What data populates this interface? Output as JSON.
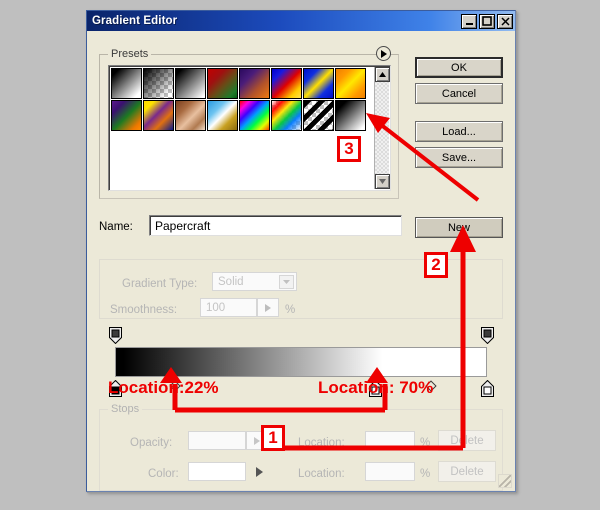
{
  "window": {
    "title": "Gradient Editor",
    "controls": [
      {
        "name": "minimize-button",
        "glyph": "_"
      },
      {
        "name": "maximize-button",
        "glyph": "□"
      },
      {
        "name": "close-button",
        "glyph": "✕"
      }
    ]
  },
  "presets": {
    "legend": "Presets",
    "menu_icon": "right-triangle-menu-icon",
    "scroll_up_icon": "scroll-up-arrow-icon",
    "scroll_down_icon": "scroll-down-arrow-icon",
    "swatches": [
      {
        "name": "foreground-to-background",
        "css": "linear-gradient(135deg,#000 0%,#000 12%,#ffffff 88%,#ffffff 100%)",
        "checker": false
      },
      {
        "name": "foreground-to-transparent",
        "css": "linear-gradient(135deg,#000 0%,rgba(0,0,0,0) 85%)",
        "checker": true
      },
      {
        "name": "black-white",
        "css": "linear-gradient(135deg,#000 0%,#000 10%,#ffffff 95%)",
        "checker": false
      },
      {
        "name": "red-green",
        "css": "linear-gradient(135deg,#c20000 0%,#a01010 30%,#6b4a16 55%,#1f7a2a 85%,#0a5c18 100%)",
        "checker": false
      },
      {
        "name": "violet-orange",
        "css": "linear-gradient(135deg,#2b0a5e 0%,#4a1c7a 30%,#b0522a 65%,#ee7a10 100%)",
        "checker": false
      },
      {
        "name": "blue-red-yellow",
        "css": "linear-gradient(135deg,#0000cc 0%,#1a1ae0 22%,#e00000 52%,#ffcc00 80%,#ffe34d 100%)",
        "checker": false
      },
      {
        "name": "blue-yellow-blue",
        "css": "linear-gradient(135deg,#0010c8 0%,#1030e0 25%,#ffe000 50%,#1030e0 75%,#0010c8 100%)",
        "checker": false
      },
      {
        "name": "orange-yellow-orange",
        "css": "linear-gradient(135deg,#f08000 0%,#ff9a00 25%,#ffe800 50%,#ff9a00 78%,#f08000 100%)",
        "checker": false
      },
      {
        "name": "violet-green-orange",
        "css": "linear-gradient(135deg,#5a1a8c 0%,#3a1070 22%,#1d7a22 52%,#f07800 85%,#ff8c00 100%)",
        "checker": false
      },
      {
        "name": "yellow-violet-orange-blue",
        "css": "linear-gradient(135deg,#ffd800 0%,#ffe400 18%,#7a2a8c 45%,#e07010 68%,#0a1a8c 100%)",
        "checker": false
      },
      {
        "name": "copper",
        "css": "linear-gradient(135deg,#7a4020 0%,#a86a40 28%,#e8c0a0 55%,#b07a50 78%,#f0dcc8 100%)",
        "checker": false
      },
      {
        "name": "blue-gold",
        "css": "linear-gradient(135deg,#2a9ae0 0%,#6ec4f0 30%,#ffffff 50%,#c8a020 72%,#8a6a10 100%)",
        "checker": false
      },
      {
        "name": "spectrum",
        "css": "linear-gradient(135deg,#ff0000 0%,#ff00e0 16%,#4000ff 33%,#00a0ff 50%,#00ff40 66%,#e0ff00 83%,#ff4000 100%)",
        "checker": false
      },
      {
        "name": "transparent-rainbow",
        "css": "linear-gradient(135deg,rgba(255,0,0,0) 0%,rgba(255,0,0,.95) 18%,rgba(255,230,0,.95) 36%,rgba(0,200,60,.95) 54%,rgba(0,120,255,.95) 72%,rgba(190,0,220,0) 100%)",
        "checker": true
      },
      {
        "name": "transparent-stripes",
        "css": "repeating-linear-gradient(135deg,#000 0 5px,rgba(0,0,0,0) 5px 10px)",
        "checker": true
      },
      {
        "name": "black-white-selected",
        "css": "linear-gradient(135deg,#000 0%,#000 18%,#ffffff 92%)",
        "checker": false
      }
    ]
  },
  "buttons": {
    "ok": "OK",
    "cancel": "Cancel",
    "load": "Load...",
    "save": "Save...",
    "new": "New"
  },
  "name_row": {
    "label": "Name:",
    "value": "Papercraft"
  },
  "gradient_type": {
    "legend": "",
    "label": "Gradient Type:",
    "value": "Solid",
    "dropdown_icon": "chevron-down-icon"
  },
  "smoothness": {
    "label": "Smoothness:",
    "value": "100",
    "unit": "%",
    "spin_icon": "right-triangle-icon"
  },
  "gradient_bar": {
    "css": "linear-gradient(to right,#000 0%,#000 2%,#ffffff 72%,#ffffff 100%)",
    "opacity_stops": [
      {
        "name": "opacity-stop-left",
        "pos_pct": 0,
        "color": "#3b3b3b"
      },
      {
        "name": "opacity-stop-right",
        "pos_pct": 100,
        "color": "#3b3b3b"
      }
    ],
    "color_stops": [
      {
        "name": "color-stop-black",
        "pos_pct": 0,
        "color": "#000000"
      },
      {
        "name": "color-stop-white-mid",
        "pos_pct": 70,
        "color": "#ffffff"
      },
      {
        "name": "color-stop-white-end",
        "pos_pct": 100,
        "color": "#ffffff"
      }
    ],
    "midpoints": [
      {
        "name": "midpoint-diamond-left",
        "pos_pct": 16
      },
      {
        "name": "midpoint-diamond-right",
        "pos_pct": 85
      }
    ]
  },
  "stops": {
    "legend": "Stops",
    "opacity_label": "Opacity:",
    "opacity_value": "",
    "opacity_unit": "%",
    "location1_label": "Location:",
    "location1_value": "",
    "location1_unit": "%",
    "delete1": "Delete",
    "color_label": "Color:",
    "color_value": "",
    "color_arrow_icon": "right-triangle-icon",
    "location2_label": "Location:",
    "location2_value": "",
    "location2_unit": "%",
    "delete2": "Delete"
  },
  "annotations": {
    "color": "#ee0000",
    "badge1": "1",
    "badge2": "2",
    "badge3": "3",
    "text_left": "Location:22%",
    "text_right": "Location: 70%"
  },
  "resize_grip_icon": "resize-grip-icon"
}
